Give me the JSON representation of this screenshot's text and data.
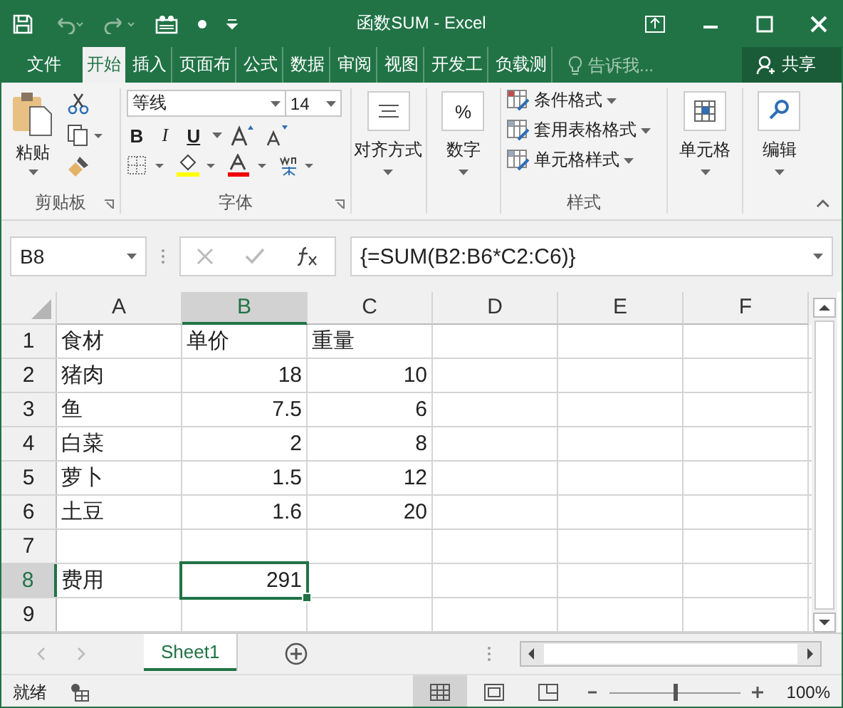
{
  "title_bar": {
    "title": "函数SUM - Excel"
  },
  "tabs": [
    {
      "label": "文件",
      "selected": false
    },
    {
      "label": "开始",
      "selected": true
    },
    {
      "label": "插入",
      "selected": false
    },
    {
      "label": "页面布",
      "selected": false
    },
    {
      "label": "公式",
      "selected": false
    },
    {
      "label": "数据",
      "selected": false
    },
    {
      "label": "审阅",
      "selected": false
    },
    {
      "label": "视图",
      "selected": false
    },
    {
      "label": "开发工",
      "selected": false
    },
    {
      "label": "负载测",
      "selected": false
    }
  ],
  "tell_me": {
    "placeholder": "告诉我..."
  },
  "share": {
    "label": "共享"
  },
  "ribbon": {
    "clipboard": {
      "label": "剪贴板",
      "paste": "粘贴"
    },
    "font": {
      "label": "字体",
      "font_name": "等线",
      "font_size": "14",
      "bold": "B",
      "italic": "I",
      "underline": "U"
    },
    "alignment": {
      "label": "对齐方式"
    },
    "number": {
      "label": "数字",
      "symbol": "%"
    },
    "styles": {
      "label": "样式",
      "items": [
        "条件格式",
        "套用表格格式",
        "单元格样式"
      ]
    },
    "cells": {
      "label": "单元格"
    },
    "editing": {
      "label": "编辑"
    }
  },
  "formula_bar": {
    "name_box": "B8",
    "formula": "{=SUM(B2:B6*C2:C6)}"
  },
  "columns": [
    {
      "label": "A",
      "selected": false
    },
    {
      "label": "B",
      "selected": true
    },
    {
      "label": "C",
      "selected": false
    },
    {
      "label": "D",
      "selected": false
    },
    {
      "label": "E",
      "selected": false
    },
    {
      "label": "F",
      "selected": false
    }
  ],
  "rows": [
    {
      "number": "1",
      "selected": false,
      "cells": [
        {
          "text": "食材",
          "kind": "text",
          "selected": false
        },
        {
          "text": "单价",
          "kind": "text",
          "selected": false
        },
        {
          "text": "重量",
          "kind": "text",
          "selected": false
        }
      ]
    },
    {
      "number": "2",
      "selected": false,
      "cells": [
        {
          "text": "猪肉",
          "kind": "text",
          "selected": false
        },
        {
          "text": "18",
          "kind": "number",
          "selected": false
        },
        {
          "text": "10",
          "kind": "number",
          "selected": false
        }
      ]
    },
    {
      "number": "3",
      "selected": false,
      "cells": [
        {
          "text": "鱼",
          "kind": "text",
          "selected": false
        },
        {
          "text": "7.5",
          "kind": "number",
          "selected": false
        },
        {
          "text": "6",
          "kind": "number",
          "selected": false
        }
      ]
    },
    {
      "number": "4",
      "selected": false,
      "cells": [
        {
          "text": "白菜",
          "kind": "text",
          "selected": false
        },
        {
          "text": "2",
          "kind": "number",
          "selected": false
        },
        {
          "text": "8",
          "kind": "number",
          "selected": false
        }
      ]
    },
    {
      "number": "5",
      "selected": false,
      "cells": [
        {
          "text": "萝卜",
          "kind": "text",
          "selected": false
        },
        {
          "text": "1.5",
          "kind": "number",
          "selected": false
        },
        {
          "text": "12",
          "kind": "number",
          "selected": false
        }
      ]
    },
    {
      "number": "6",
      "selected": false,
      "cells": [
        {
          "text": "土豆",
          "kind": "text",
          "selected": false
        },
        {
          "text": "1.6",
          "kind": "number",
          "selected": false
        },
        {
          "text": "20",
          "kind": "number",
          "selected": false
        }
      ]
    },
    {
      "number": "7",
      "selected": false
    },
    {
      "number": "8",
      "selected": true,
      "cells": [
        {
          "text": "费用",
          "kind": "text",
          "selected": false
        },
        {
          "text": "291",
          "kind": "number",
          "selected": true
        }
      ]
    },
    {
      "number": "9",
      "selected": false
    }
  ],
  "sheet_tabs": [
    {
      "label": "Sheet1",
      "selected": true
    }
  ],
  "status_bar": {
    "status": "就绪",
    "views": [
      {
        "selected": true
      },
      {
        "selected": false
      },
      {
        "selected": false
      }
    ],
    "zoom_slider": {
      "level": 0.5
    },
    "zoom": "100%"
  }
}
